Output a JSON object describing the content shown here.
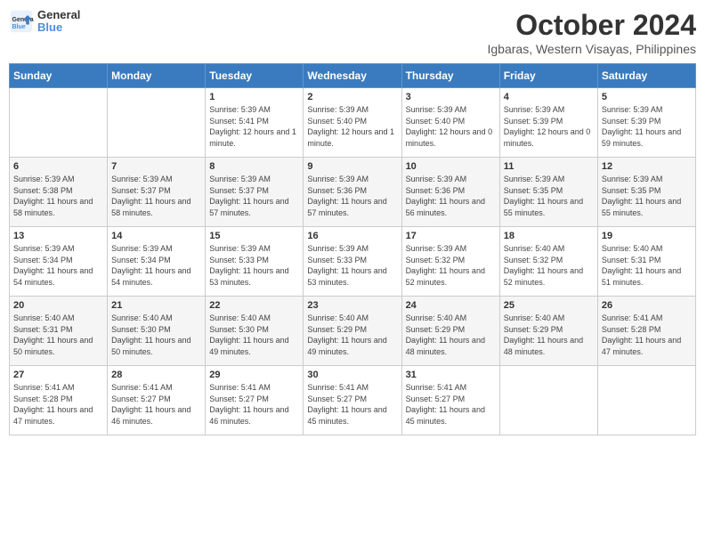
{
  "header": {
    "logo_line1": "General",
    "logo_line2": "Blue",
    "month": "October 2024",
    "location": "Igbaras, Western Visayas, Philippines"
  },
  "days_of_week": [
    "Sunday",
    "Monday",
    "Tuesday",
    "Wednesday",
    "Thursday",
    "Friday",
    "Saturday"
  ],
  "weeks": [
    [
      {
        "day": "",
        "sunrise": "",
        "sunset": "",
        "daylight": ""
      },
      {
        "day": "",
        "sunrise": "",
        "sunset": "",
        "daylight": ""
      },
      {
        "day": "1",
        "sunrise": "Sunrise: 5:39 AM",
        "sunset": "Sunset: 5:41 PM",
        "daylight": "Daylight: 12 hours and 1 minute."
      },
      {
        "day": "2",
        "sunrise": "Sunrise: 5:39 AM",
        "sunset": "Sunset: 5:40 PM",
        "daylight": "Daylight: 12 hours and 1 minute."
      },
      {
        "day": "3",
        "sunrise": "Sunrise: 5:39 AM",
        "sunset": "Sunset: 5:40 PM",
        "daylight": "Daylight: 12 hours and 0 minutes."
      },
      {
        "day": "4",
        "sunrise": "Sunrise: 5:39 AM",
        "sunset": "Sunset: 5:39 PM",
        "daylight": "Daylight: 12 hours and 0 minutes."
      },
      {
        "day": "5",
        "sunrise": "Sunrise: 5:39 AM",
        "sunset": "Sunset: 5:39 PM",
        "daylight": "Daylight: 11 hours and 59 minutes."
      }
    ],
    [
      {
        "day": "6",
        "sunrise": "Sunrise: 5:39 AM",
        "sunset": "Sunset: 5:38 PM",
        "daylight": "Daylight: 11 hours and 58 minutes."
      },
      {
        "day": "7",
        "sunrise": "Sunrise: 5:39 AM",
        "sunset": "Sunset: 5:37 PM",
        "daylight": "Daylight: 11 hours and 58 minutes."
      },
      {
        "day": "8",
        "sunrise": "Sunrise: 5:39 AM",
        "sunset": "Sunset: 5:37 PM",
        "daylight": "Daylight: 11 hours and 57 minutes."
      },
      {
        "day": "9",
        "sunrise": "Sunrise: 5:39 AM",
        "sunset": "Sunset: 5:36 PM",
        "daylight": "Daylight: 11 hours and 57 minutes."
      },
      {
        "day": "10",
        "sunrise": "Sunrise: 5:39 AM",
        "sunset": "Sunset: 5:36 PM",
        "daylight": "Daylight: 11 hours and 56 minutes."
      },
      {
        "day": "11",
        "sunrise": "Sunrise: 5:39 AM",
        "sunset": "Sunset: 5:35 PM",
        "daylight": "Daylight: 11 hours and 55 minutes."
      },
      {
        "day": "12",
        "sunrise": "Sunrise: 5:39 AM",
        "sunset": "Sunset: 5:35 PM",
        "daylight": "Daylight: 11 hours and 55 minutes."
      }
    ],
    [
      {
        "day": "13",
        "sunrise": "Sunrise: 5:39 AM",
        "sunset": "Sunset: 5:34 PM",
        "daylight": "Daylight: 11 hours and 54 minutes."
      },
      {
        "day": "14",
        "sunrise": "Sunrise: 5:39 AM",
        "sunset": "Sunset: 5:34 PM",
        "daylight": "Daylight: 11 hours and 54 minutes."
      },
      {
        "day": "15",
        "sunrise": "Sunrise: 5:39 AM",
        "sunset": "Sunset: 5:33 PM",
        "daylight": "Daylight: 11 hours and 53 minutes."
      },
      {
        "day": "16",
        "sunrise": "Sunrise: 5:39 AM",
        "sunset": "Sunset: 5:33 PM",
        "daylight": "Daylight: 11 hours and 53 minutes."
      },
      {
        "day": "17",
        "sunrise": "Sunrise: 5:39 AM",
        "sunset": "Sunset: 5:32 PM",
        "daylight": "Daylight: 11 hours and 52 minutes."
      },
      {
        "day": "18",
        "sunrise": "Sunrise: 5:40 AM",
        "sunset": "Sunset: 5:32 PM",
        "daylight": "Daylight: 11 hours and 52 minutes."
      },
      {
        "day": "19",
        "sunrise": "Sunrise: 5:40 AM",
        "sunset": "Sunset: 5:31 PM",
        "daylight": "Daylight: 11 hours and 51 minutes."
      }
    ],
    [
      {
        "day": "20",
        "sunrise": "Sunrise: 5:40 AM",
        "sunset": "Sunset: 5:31 PM",
        "daylight": "Daylight: 11 hours and 50 minutes."
      },
      {
        "day": "21",
        "sunrise": "Sunrise: 5:40 AM",
        "sunset": "Sunset: 5:30 PM",
        "daylight": "Daylight: 11 hours and 50 minutes."
      },
      {
        "day": "22",
        "sunrise": "Sunrise: 5:40 AM",
        "sunset": "Sunset: 5:30 PM",
        "daylight": "Daylight: 11 hours and 49 minutes."
      },
      {
        "day": "23",
        "sunrise": "Sunrise: 5:40 AM",
        "sunset": "Sunset: 5:29 PM",
        "daylight": "Daylight: 11 hours and 49 minutes."
      },
      {
        "day": "24",
        "sunrise": "Sunrise: 5:40 AM",
        "sunset": "Sunset: 5:29 PM",
        "daylight": "Daylight: 11 hours and 48 minutes."
      },
      {
        "day": "25",
        "sunrise": "Sunrise: 5:40 AM",
        "sunset": "Sunset: 5:29 PM",
        "daylight": "Daylight: 11 hours and 48 minutes."
      },
      {
        "day": "26",
        "sunrise": "Sunrise: 5:41 AM",
        "sunset": "Sunset: 5:28 PM",
        "daylight": "Daylight: 11 hours and 47 minutes."
      }
    ],
    [
      {
        "day": "27",
        "sunrise": "Sunrise: 5:41 AM",
        "sunset": "Sunset: 5:28 PM",
        "daylight": "Daylight: 11 hours and 47 minutes."
      },
      {
        "day": "28",
        "sunrise": "Sunrise: 5:41 AM",
        "sunset": "Sunset: 5:27 PM",
        "daylight": "Daylight: 11 hours and 46 minutes."
      },
      {
        "day": "29",
        "sunrise": "Sunrise: 5:41 AM",
        "sunset": "Sunset: 5:27 PM",
        "daylight": "Daylight: 11 hours and 46 minutes."
      },
      {
        "day": "30",
        "sunrise": "Sunrise: 5:41 AM",
        "sunset": "Sunset: 5:27 PM",
        "daylight": "Daylight: 11 hours and 45 minutes."
      },
      {
        "day": "31",
        "sunrise": "Sunrise: 5:41 AM",
        "sunset": "Sunset: 5:27 PM",
        "daylight": "Daylight: 11 hours and 45 minutes."
      },
      {
        "day": "",
        "sunrise": "",
        "sunset": "",
        "daylight": ""
      },
      {
        "day": "",
        "sunrise": "",
        "sunset": "",
        "daylight": ""
      }
    ]
  ]
}
